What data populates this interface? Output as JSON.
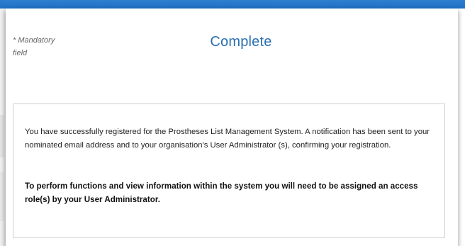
{
  "form": {
    "mandatory_note_line1": "* Mandatory",
    "mandatory_note_line2": "field",
    "title": "Complete"
  },
  "message": {
    "success_text": "You have successfully registered for the Prostheses List Management System. A notification has been sent to your nominated email address and to your organisation's User Administrator (s), confirming your registration.",
    "role_notice": "To perform functions and view information within the system you will need to be assigned an access role(s) by your User Administrator."
  },
  "colors": {
    "top_bar": "#1e6fc4",
    "heading": "#2b6fb0"
  }
}
